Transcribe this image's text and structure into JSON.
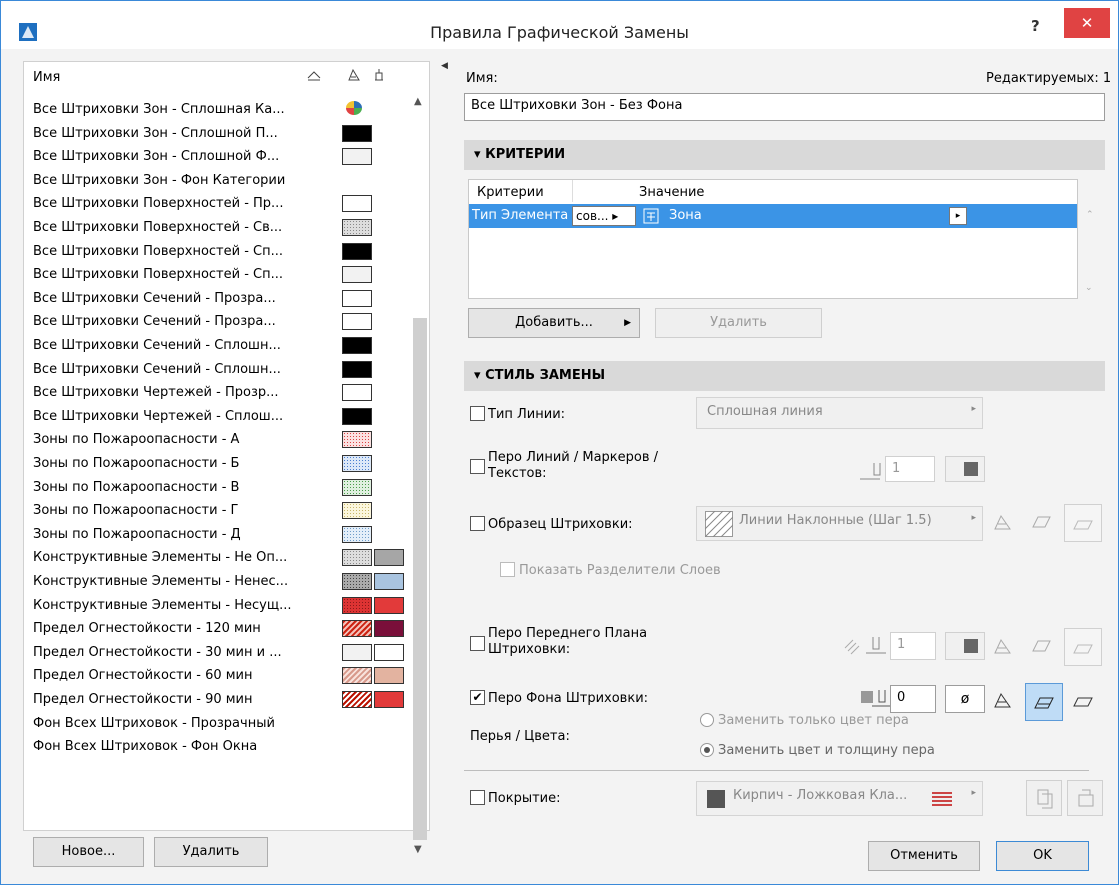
{
  "window": {
    "title": "Правила Графической Замены",
    "help_label": "?",
    "close_label": "✕"
  },
  "list": {
    "header": {
      "name_col": "Имя"
    },
    "rows": [
      {
        "label": "Все Штриховки Зон - Сплошная Ка...",
        "sw1": "multi",
        "sw2": null
      },
      {
        "label": "Все Штриховки Зон - Сплошной П...",
        "sw1": "#000000",
        "sw2": null
      },
      {
        "label": "Все Штриховки Зон - Сплошной Ф...",
        "sw1": "#f2f2f2",
        "sw2": null
      },
      {
        "label": "Все Штриховки Зон - Фон Категории",
        "sw1": null,
        "sw2": null
      },
      {
        "label": "Все Штриховки Поверхностей - Пр...",
        "sw1": "#ffffff",
        "sw2": null
      },
      {
        "label": "Все Штриховки Поверхностей - Св...",
        "sw1": "dots-grey",
        "sw2": null
      },
      {
        "label": "Все Штриховки Поверхностей - Сп...",
        "sw1": "#000000",
        "sw2": null
      },
      {
        "label": "Все Штриховки Поверхностей - Сп...",
        "sw1": "#f2f2f2",
        "sw2": null
      },
      {
        "label": "Все Штриховки Сечений - Прозра...",
        "sw1": "#ffffff",
        "sw2": null
      },
      {
        "label": "Все Штриховки Сечений - Прозра...",
        "sw1": "#ffffff",
        "sw2": null
      },
      {
        "label": "Все Штриховки Сечений - Сплошн...",
        "sw1": "#000000",
        "sw2": null
      },
      {
        "label": "Все Штриховки Сечений - Сплошн...",
        "sw1": "#000000",
        "sw2": null
      },
      {
        "label": "Все Штриховки Чертежей - Прозр...",
        "sw1": "#ffffff",
        "sw2": null
      },
      {
        "label": "Все Штриховки Чертежей - Сплош...",
        "sw1": "#000000",
        "sw2": null
      },
      {
        "label": "Зоны по Пожароопасности - А",
        "sw1": "dots-red",
        "sw2": null
      },
      {
        "label": "Зоны по Пожароопасности - Б",
        "sw1": "dots-blue",
        "sw2": null
      },
      {
        "label": "Зоны по Пожароопасности - В",
        "sw1": "dots-green",
        "sw2": null
      },
      {
        "label": "Зоны по Пожароопасности - Г",
        "sw1": "dots-yellow",
        "sw2": null
      },
      {
        "label": "Зоны по Пожароопасности - Д",
        "sw1": "dots-lightblue",
        "sw2": null
      },
      {
        "label": "Конструктивные Элементы - Не Оп...",
        "sw1": "dots-grey",
        "sw2": "#a6a6a6"
      },
      {
        "label": "Конструктивные Элементы - Ненес...",
        "sw1": "dots-dark",
        "sw2": "#a9c4e0"
      },
      {
        "label": "Конструктивные Элементы - Несущ...",
        "sw1": "dots-darkred",
        "sw2": "#e23a3a"
      },
      {
        "label": "Предел Огнестойкости - 120 мин",
        "sw1": "hatch-red",
        "sw2": "#7a0f3a"
      },
      {
        "label": "Предел Огнестойкости - 30 мин и ...",
        "sw1": "#f2f2f2",
        "sw2": "#ffffff"
      },
      {
        "label": "Предел Огнестойкости - 60 мин",
        "sw1": "hatch-pink",
        "sw2": "#e3b3a0"
      },
      {
        "label": "Предел Огнестойкости - 90 мин",
        "sw1": "hatch-red2",
        "sw2": "#e23a3a"
      },
      {
        "label": "Фон Всех Штриховок - Прозрачный",
        "sw1": null,
        "sw2": null
      },
      {
        "label": "Фон Всех Штриховок - Фон Окна",
        "sw1": null,
        "sw2": null
      }
    ],
    "new_button": "Новое...",
    "delete_button": "Удалить"
  },
  "detail": {
    "name_label": "Имя:",
    "editable_count": "Редактируемых: 1",
    "name_value": "Все Штриховки Зон - Без Фона",
    "criteria": {
      "title": "КРИТЕРИИ",
      "col_criterion": "Критерии",
      "col_value": "Значение",
      "row": {
        "criterion": "Тип Элемента",
        "operator": "сов...",
        "value": "Зона"
      },
      "add_button": "Добавить...",
      "delete_button": "Удалить"
    },
    "style": {
      "title": "СТИЛЬ ЗАМЕНЫ",
      "line_type": {
        "label": "Тип Линии:",
        "value": "Сплошная линия",
        "checked": false
      },
      "line_pen": {
        "label_1": "Перо Линий / Маркеров /",
        "label_2": "Текстов:",
        "pen": "1",
        "checked": false
      },
      "fill_pattern": {
        "label": "Образец Штриховки:",
        "value": "Линии Наклонные (Шаг 1.5)",
        "checked": false
      },
      "show_layer_sep": {
        "label": "Показать Разделители Слоев",
        "checked": false
      },
      "fg_pen": {
        "label_1": "Перо Переднего Плана",
        "label_2": "Штриховки:",
        "pen": "1",
        "checked": false
      },
      "bg_pen": {
        "label": "Перо Фона Штриховки:",
        "pen": "0",
        "checked": true
      },
      "pens_colors": {
        "label": "Перья / Цвета:",
        "opt1": "Заменить только цвет пера",
        "opt2": "Заменить цвет и толщину пера",
        "selected": 2
      },
      "surface": {
        "label": "Покрытие:",
        "value": "Кирпич - Ложковая Кла...",
        "checked": false
      }
    },
    "cancel_button": "Отменить",
    "ok_button": "OK"
  }
}
